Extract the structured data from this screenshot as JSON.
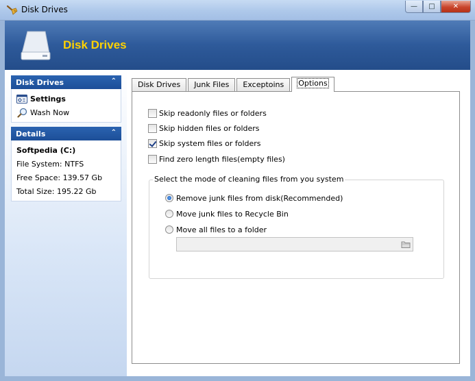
{
  "window": {
    "title": "Disk Drives",
    "minimize_glyph": "—",
    "maximize_glyph": "□",
    "close_glyph": "✕"
  },
  "banner": {
    "title": "Disk Drives",
    "icon": "drive-icon"
  },
  "sidebar": {
    "disk_panel": {
      "title": "Disk Drives",
      "collapse_glyph": "⌃",
      "items": [
        {
          "label": "Settings",
          "icon": "settings-icon",
          "selected": true
        },
        {
          "label": "Wash Now",
          "icon": "magnifier-icon",
          "selected": false
        }
      ]
    },
    "details_panel": {
      "title": "Details",
      "collapse_glyph": "⌃",
      "drive_name": "Softpedia (C:)",
      "file_system": "File System: NTFS",
      "free_space": "Free Space: 139.57 Gb",
      "total_size": "Total Size: 195.22 Gb"
    }
  },
  "tabs": [
    {
      "label": "Disk Drives",
      "active": false
    },
    {
      "label": "Junk Files",
      "active": false
    },
    {
      "label": "Exceptoins",
      "active": false
    },
    {
      "label": "Options",
      "active": true
    }
  ],
  "options": {
    "checkboxes": [
      {
        "label": "Skip readonly files or folders",
        "checked": false
      },
      {
        "label": "Skip hidden files or folders",
        "checked": false
      },
      {
        "label": "Skip system files or folders",
        "checked": true
      },
      {
        "label": "Find zero length files(empty files)",
        "checked": false
      }
    ],
    "mode_group": {
      "legend": "Select the mode of cleaning files from you system",
      "radios": [
        {
          "label": "Remove junk files from disk(Recommended)",
          "checked": true
        },
        {
          "label": "Move junk files to Recycle Bin",
          "checked": false
        },
        {
          "label": "Move all files to a folder",
          "checked": false
        }
      ],
      "folder_path": ""
    }
  },
  "colors": {
    "banner_title": "#ffd200",
    "panel_header": "#1d4e98",
    "banner_bg": "#2e5a9a"
  }
}
